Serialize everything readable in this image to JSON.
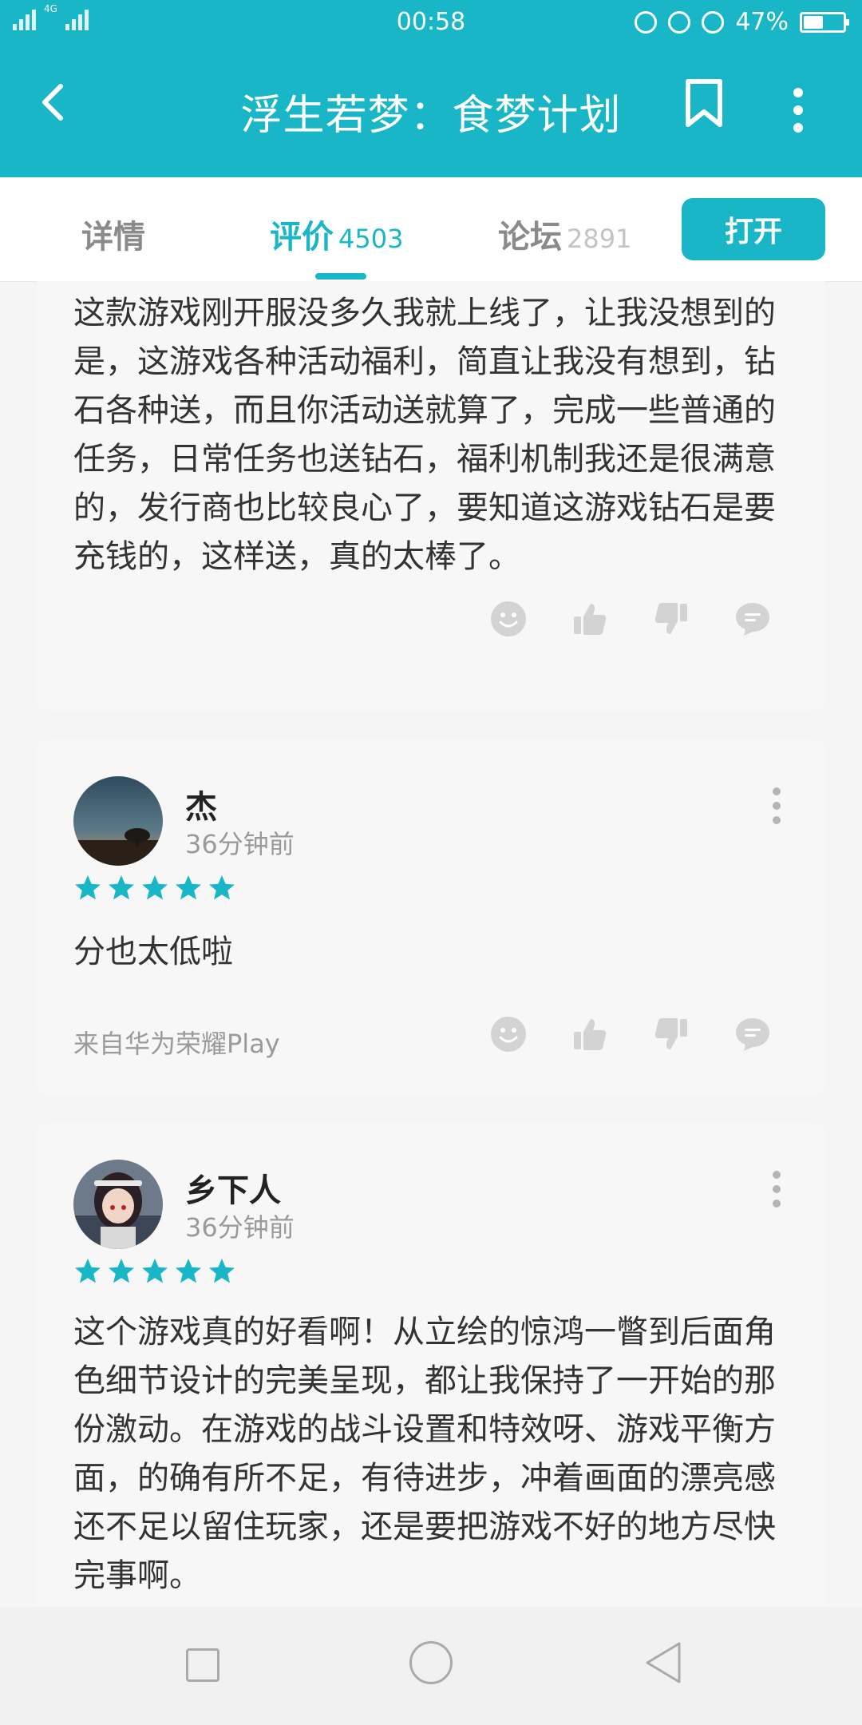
{
  "status_bar": {
    "network": "4G",
    "time": "00:58",
    "battery": "47%"
  },
  "app_bar": {
    "title": "浮生若梦：食梦计划"
  },
  "tabs": [
    {
      "label": "详情",
      "count": ""
    },
    {
      "label": "评价",
      "count": "4503"
    },
    {
      "label": "论坛",
      "count": "2891"
    }
  ],
  "open_button": "打开",
  "reviews": [
    {
      "text": "这款游戏刚开服没多久我就上线了，让我没想到的是，这游戏各种活动福利，简直让我没有想到，钻石各种送，而且你活动送就算了，完成一些普通的任务，日常任务也送钻石，福利机制我还是很满意的，发行商也比较良心了，要知道这游戏钻石是要充钱的，这样送，真的太棒了。"
    },
    {
      "username": "杰",
      "time": "36分钟前",
      "rating": 5,
      "text": "分也太低啦",
      "source": "来自华为荣耀Play"
    },
    {
      "username": "乡下人",
      "time": "36分钟前",
      "rating": 5,
      "text": "这个游戏真的好看啊！从立绘的惊鸿一瞥到后面角色细节设计的完美呈现，都让我保持了一开始的那份激动。在游戏的战斗设置和特效呀、游戏平衡方面，的确有所不足，有待进步，冲着画面的漂亮感还不足以留住玩家，还是要把游戏不好的地方尽快完事啊。"
    }
  ],
  "colors": {
    "accent": "#18b6c7",
    "card_bg": "#f7f7f7",
    "icon_gray": "#d0d0d0"
  },
  "icons": [
    "back-arrow-icon",
    "bookmark-icon",
    "more-vertical-icon",
    "smile-icon",
    "thumbs-up-icon",
    "thumbs-down-icon",
    "comment-icon",
    "star-icon",
    "nav-recent-icon",
    "nav-home-icon",
    "nav-back-icon"
  ]
}
